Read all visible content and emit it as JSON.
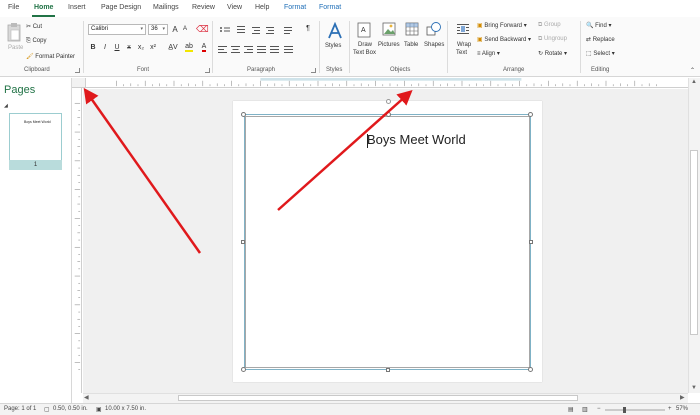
{
  "tabs": [
    "File",
    "Home",
    "Insert",
    "Page Design",
    "Mailings",
    "Review",
    "View",
    "Help",
    "Format",
    "Format"
  ],
  "clipboard": {
    "paste": "Paste",
    "cut": "Cut",
    "copy": "Copy",
    "format_painter": "Format Painter",
    "label": "Clipboard"
  },
  "font": {
    "name": "Calibri",
    "size": "36",
    "label": "Font",
    "bold": "B",
    "italic": "I",
    "underline": "U",
    "strike": "x",
    "sub": "x₂",
    "super": "x²",
    "grow": "A",
    "shrink": "A"
  },
  "paragraph": {
    "label": "Paragraph",
    "pilcrow": "¶"
  },
  "styles": {
    "btn": "Styles",
    "label": "Styles"
  },
  "objects": {
    "draw_textbox_1": "Draw",
    "draw_textbox_2": "Text Box",
    "pictures": "Pictures",
    "table": "Table",
    "shapes": "Shapes",
    "label": "Objects"
  },
  "arrange": {
    "wrap_1": "Wrap",
    "wrap_2": "Text",
    "bring_forward": "Bring Forward",
    "send_backward": "Send Backward",
    "align": "Align",
    "group": "Group",
    "ungroup": "Ungroup",
    "rotate": "Rotate",
    "label": "Arrange"
  },
  "editing": {
    "find": "Find",
    "replace": "Replace",
    "select": "Select",
    "label": "Editing"
  },
  "pages_pane": {
    "title": "Pages",
    "thumb_title": "Boys Meet World",
    "page_num": "1"
  },
  "document": {
    "heading": "Boys Meet World"
  },
  "status": {
    "page": "Page: 1 of 1",
    "position": "0.50, 0.50 in.",
    "size": "10.00 x 7.50 in.",
    "zoom": "57%"
  },
  "colors": {
    "accent": "#217346",
    "context_tab": "#1f6fb8",
    "annotation": "#e0191c"
  }
}
